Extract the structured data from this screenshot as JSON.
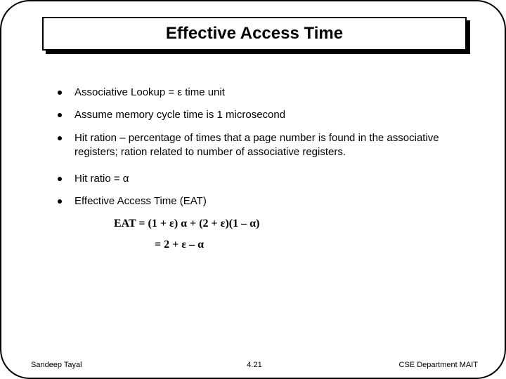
{
  "title": "Effective Access Time",
  "bullets": [
    "Associative Lookup = ε time unit",
    "Assume memory cycle time is 1 microsecond",
    "Hit ration – percentage of times that a page number is found in the associative registers; ration related to number of associative registers.",
    "Hit ratio = α",
    "Effective Access Time (EAT)"
  ],
  "equations": {
    "line1": "EAT = (1 + ε) α + (2 + ε)(1 – α)",
    "line2": "= 2 + ε – α"
  },
  "footer": {
    "left": "Sandeep Tayal",
    "center": "4.21",
    "right": "CSE Department MAIT"
  }
}
